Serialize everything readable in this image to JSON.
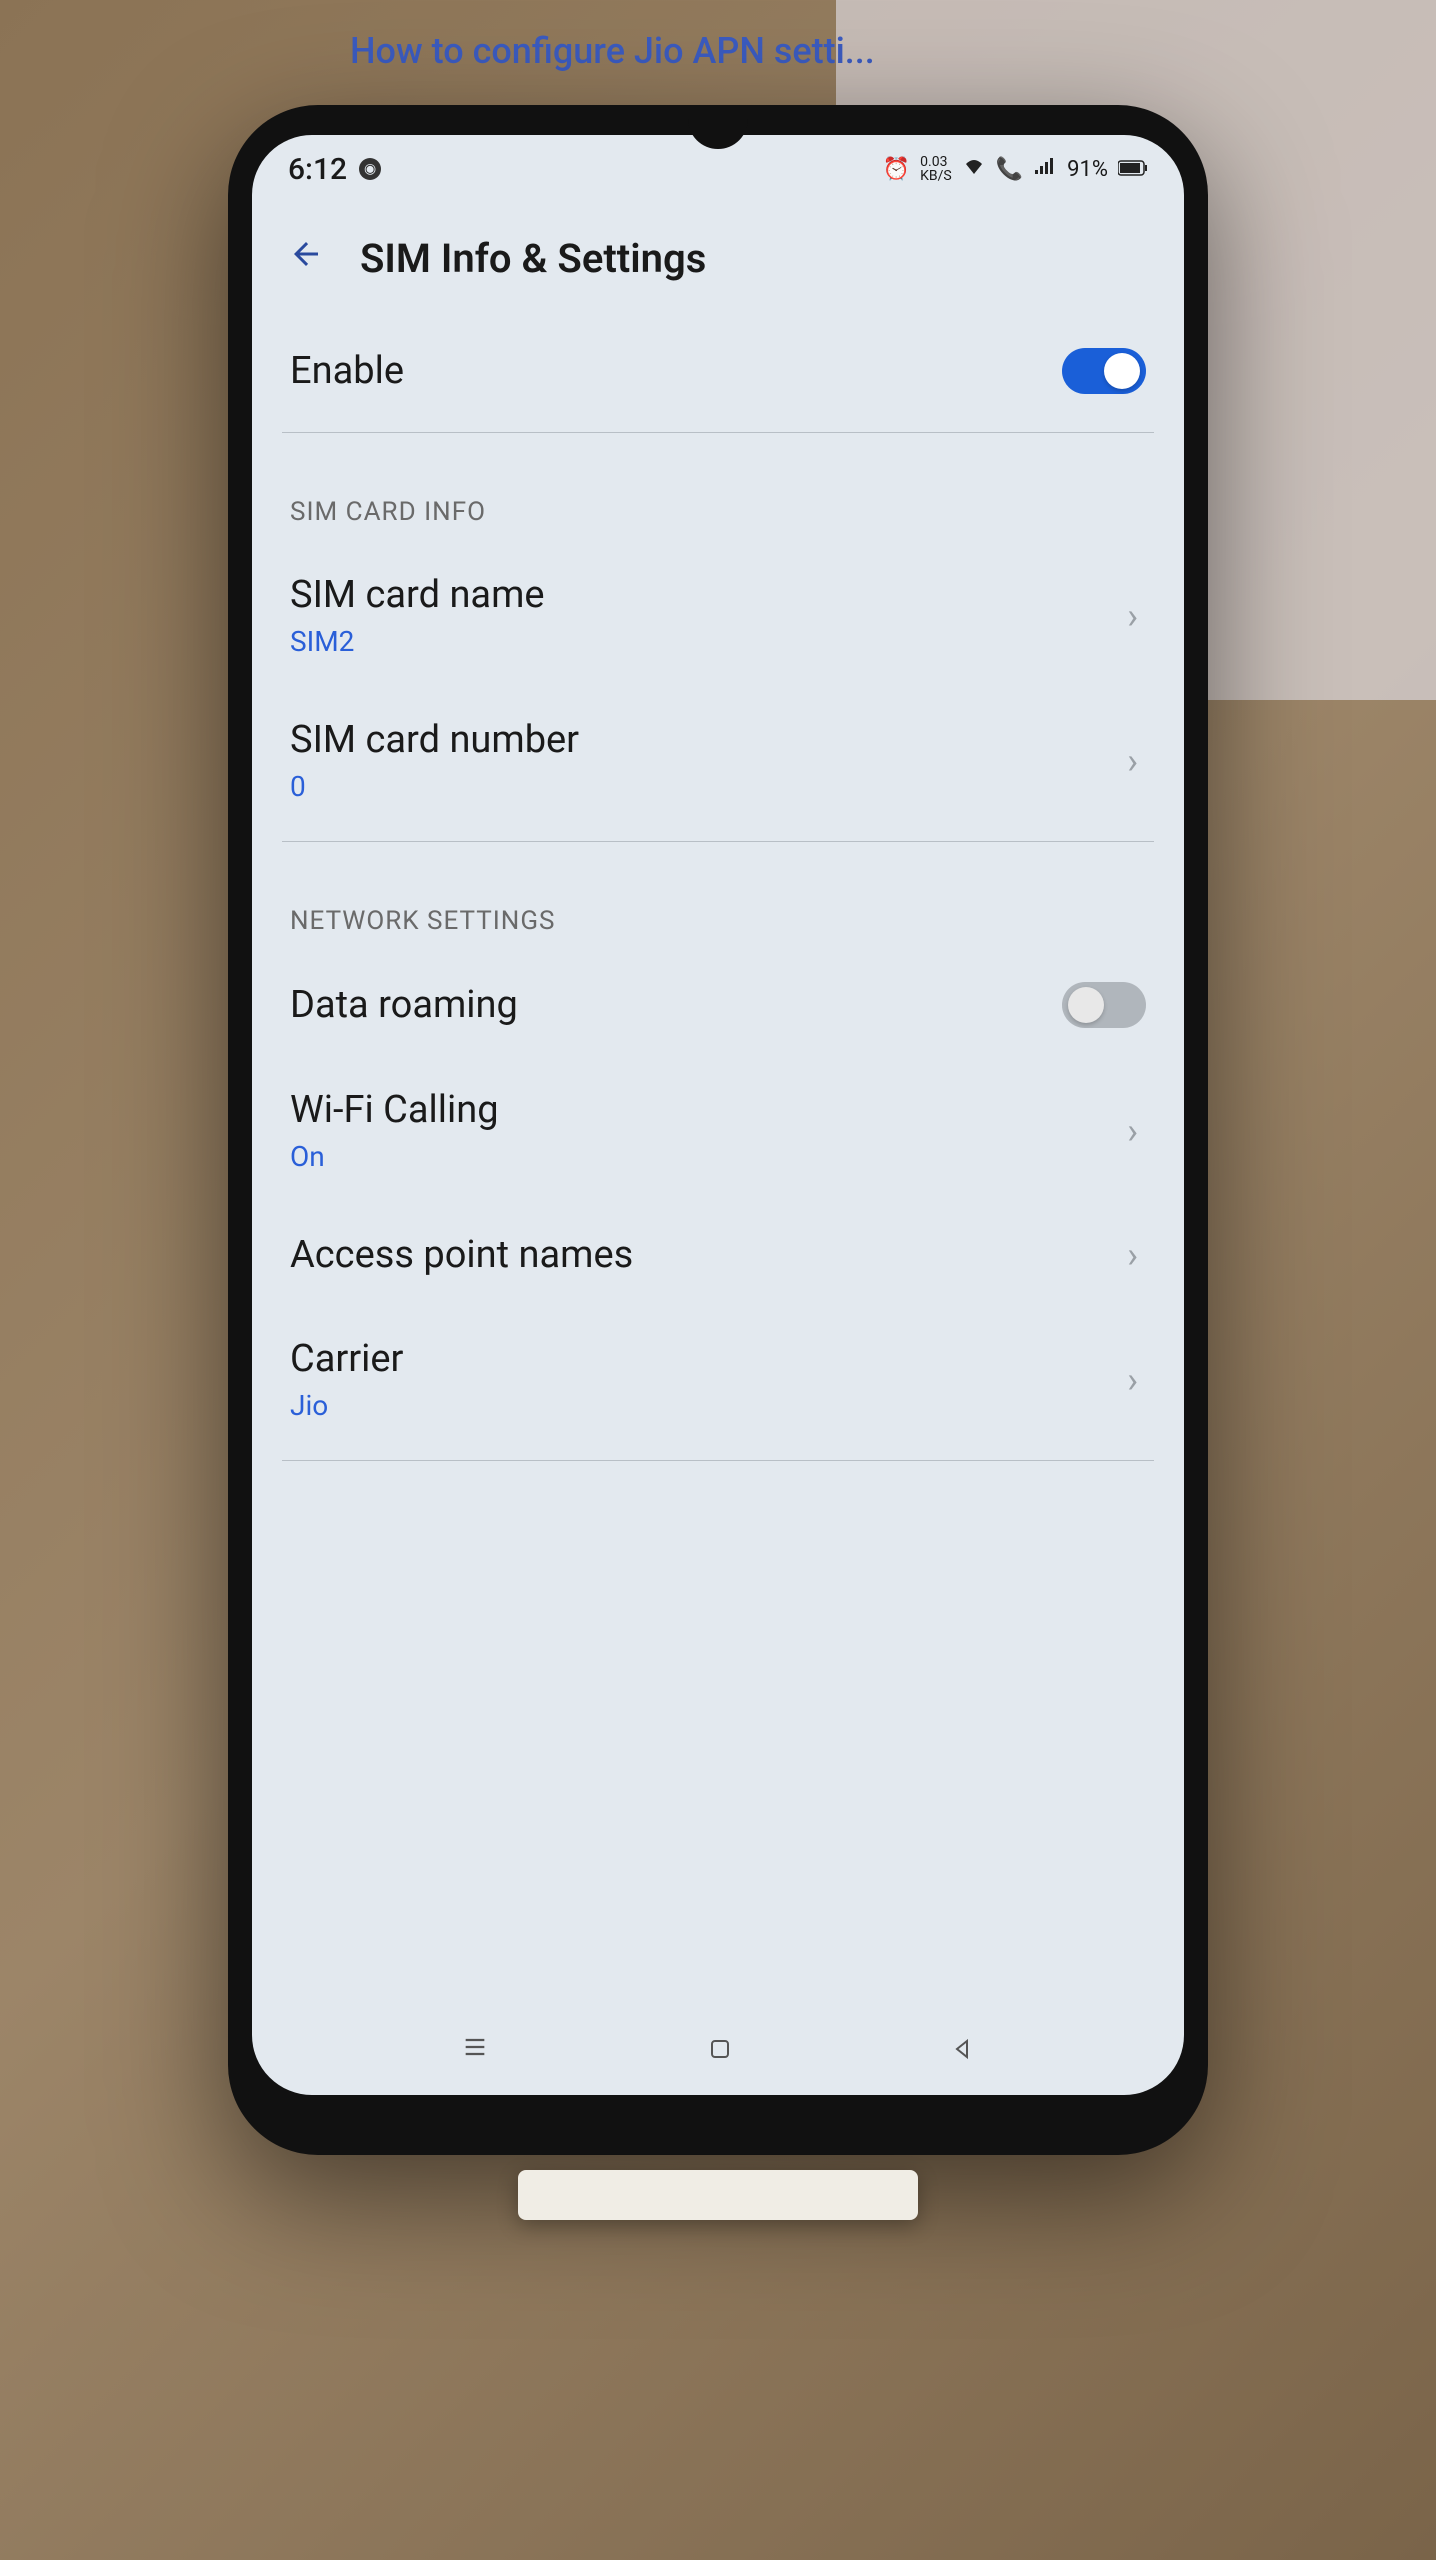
{
  "background": {
    "monitor_text": "How to configure Jio APN setti..."
  },
  "status": {
    "time": "6:12",
    "net_speed_top": "0.03",
    "net_speed_bottom": "KB/S",
    "battery": "91%"
  },
  "header": {
    "title": "SIM Info & Settings"
  },
  "enable": {
    "label": "Enable",
    "value": true
  },
  "sections": [
    {
      "title": "SIM CARD INFO",
      "items": [
        {
          "label": "SIM card name",
          "value": "SIM2",
          "type": "nav"
        },
        {
          "label": "SIM card number",
          "value": "0",
          "type": "nav"
        }
      ]
    },
    {
      "title": "NETWORK SETTINGS",
      "items": [
        {
          "label": "Data roaming",
          "value": false,
          "type": "toggle"
        },
        {
          "label": "Wi-Fi Calling",
          "value": "On",
          "type": "nav"
        },
        {
          "label": "Access point names",
          "value": "",
          "type": "nav"
        },
        {
          "label": "Carrier",
          "value": "Jio",
          "type": "nav"
        }
      ]
    }
  ]
}
